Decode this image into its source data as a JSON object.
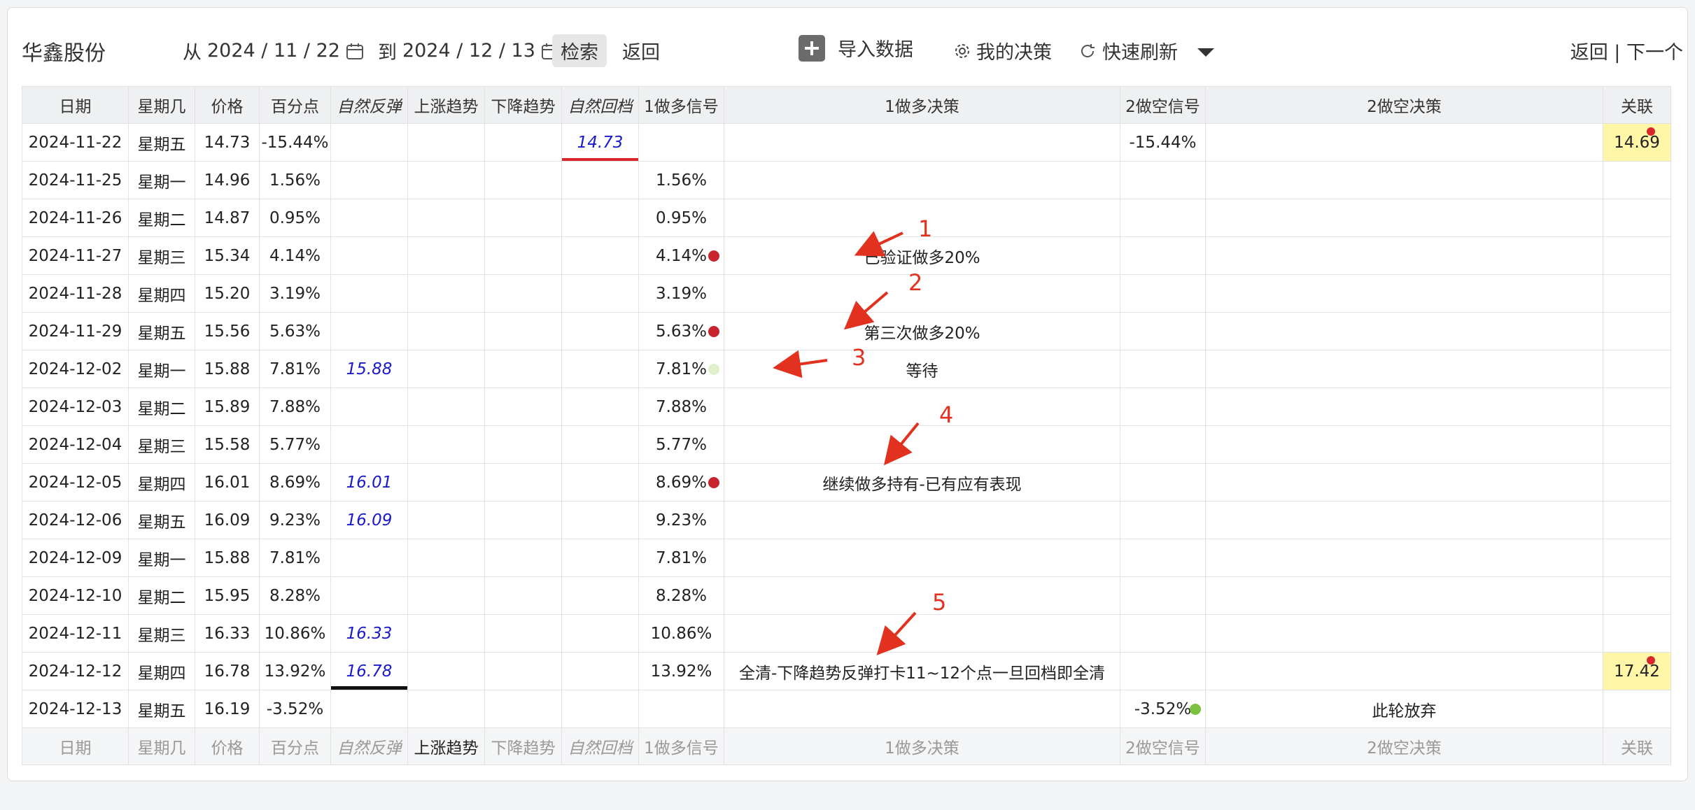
{
  "toolbar": {
    "title": "华鑫股份",
    "date_from_label": "从",
    "date_from": "2024 / 11 / 22",
    "date_to_label": "到",
    "date_to": "2024 / 12 / 13",
    "search_label": "检索",
    "back_label": "返回",
    "import_label": "导入数据",
    "decision_label": "我的决策",
    "refresh_label": "快速刷新",
    "nav_back": "返回",
    "nav_sep": "|",
    "nav_next": "下一个"
  },
  "columns": [
    "日期",
    "星期几",
    "价格",
    "百分点",
    "自然反弹",
    "上涨趋势",
    "下降趋势",
    "自然回档",
    "1做多信号",
    "1做多决策",
    "2做空信号",
    "2做空决策",
    "关联"
  ],
  "rows": [
    {
      "date": "2024-11-22",
      "weekday": "星期五",
      "price": "14.73",
      "pct": "-15.44%",
      "rebound": "",
      "up": "",
      "down": "",
      "pullback": "14.73",
      "sig1": "",
      "dec1": "",
      "sig2": "-15.44%",
      "dec2": "",
      "link": "14.69"
    },
    {
      "date": "2024-11-25",
      "weekday": "星期一",
      "price": "14.96",
      "pct": "1.56%",
      "rebound": "",
      "up": "",
      "down": "",
      "pullback": "",
      "sig1": "1.56%",
      "dec1": "",
      "sig2": "",
      "dec2": "",
      "link": ""
    },
    {
      "date": "2024-11-26",
      "weekday": "星期二",
      "price": "14.87",
      "pct": "0.95%",
      "rebound": "",
      "up": "",
      "down": "",
      "pullback": "",
      "sig1": "0.95%",
      "dec1": "",
      "sig2": "",
      "dec2": "",
      "link": ""
    },
    {
      "date": "2024-11-27",
      "weekday": "星期三",
      "price": "15.34",
      "pct": "4.14%",
      "rebound": "",
      "up": "",
      "down": "",
      "pullback": "",
      "sig1": "4.14%",
      "dec1": "已验证做多20%",
      "sig2": "",
      "dec2": "",
      "link": ""
    },
    {
      "date": "2024-11-28",
      "weekday": "星期四",
      "price": "15.20",
      "pct": "3.19%",
      "rebound": "",
      "up": "",
      "down": "",
      "pullback": "",
      "sig1": "3.19%",
      "dec1": "",
      "sig2": "",
      "dec2": "",
      "link": ""
    },
    {
      "date": "2024-11-29",
      "weekday": "星期五",
      "price": "15.56",
      "pct": "5.63%",
      "rebound": "",
      "up": "",
      "down": "",
      "pullback": "",
      "sig1": "5.63%",
      "dec1": "第三次做多20%",
      "sig2": "",
      "dec2": "",
      "link": ""
    },
    {
      "date": "2024-12-02",
      "weekday": "星期一",
      "price": "15.88",
      "pct": "7.81%",
      "rebound": "15.88",
      "up": "",
      "down": "",
      "pullback": "",
      "sig1": "7.81%",
      "dec1": "等待",
      "sig2": "",
      "dec2": "",
      "link": ""
    },
    {
      "date": "2024-12-03",
      "weekday": "星期二",
      "price": "15.89",
      "pct": "7.88%",
      "rebound": "",
      "up": "",
      "down": "",
      "pullback": "",
      "sig1": "7.88%",
      "dec1": "",
      "sig2": "",
      "dec2": "",
      "link": ""
    },
    {
      "date": "2024-12-04",
      "weekday": "星期三",
      "price": "15.58",
      "pct": "5.77%",
      "rebound": "",
      "up": "",
      "down": "",
      "pullback": "",
      "sig1": "5.77%",
      "dec1": "",
      "sig2": "",
      "dec2": "",
      "link": ""
    },
    {
      "date": "2024-12-05",
      "weekday": "星期四",
      "price": "16.01",
      "pct": "8.69%",
      "rebound": "16.01",
      "up": "",
      "down": "",
      "pullback": "",
      "sig1": "8.69%",
      "dec1": "继续做多持有-已有应有表现",
      "sig2": "",
      "dec2": "",
      "link": ""
    },
    {
      "date": "2024-12-06",
      "weekday": "星期五",
      "price": "16.09",
      "pct": "9.23%",
      "rebound": "16.09",
      "up": "",
      "down": "",
      "pullback": "",
      "sig1": "9.23%",
      "dec1": "",
      "sig2": "",
      "dec2": "",
      "link": ""
    },
    {
      "date": "2024-12-09",
      "weekday": "星期一",
      "price": "15.88",
      "pct": "7.81%",
      "rebound": "",
      "up": "",
      "down": "",
      "pullback": "",
      "sig1": "7.81%",
      "dec1": "",
      "sig2": "",
      "dec2": "",
      "link": ""
    },
    {
      "date": "2024-12-10",
      "weekday": "星期二",
      "price": "15.95",
      "pct": "8.28%",
      "rebound": "",
      "up": "",
      "down": "",
      "pullback": "",
      "sig1": "8.28%",
      "dec1": "",
      "sig2": "",
      "dec2": "",
      "link": ""
    },
    {
      "date": "2024-12-11",
      "weekday": "星期三",
      "price": "16.33",
      "pct": "10.86%",
      "rebound": "16.33",
      "up": "",
      "down": "",
      "pullback": "",
      "sig1": "10.86%",
      "dec1": "",
      "sig2": "",
      "dec2": "",
      "link": ""
    },
    {
      "date": "2024-12-12",
      "weekday": "星期四",
      "price": "16.78",
      "pct": "13.92%",
      "rebound": "16.78",
      "up": "",
      "down": "",
      "pullback": "",
      "sig1": "13.92%",
      "dec1": "全清-下降趋势反弹打卡11~12个点一旦回档即全清",
      "sig2": "",
      "dec2": "",
      "link": "17.42"
    },
    {
      "date": "2024-12-13",
      "weekday": "星期五",
      "price": "16.19",
      "pct": "-3.52%",
      "rebound": "",
      "up": "",
      "down": "",
      "pullback": "",
      "sig1": "",
      "dec1": "",
      "sig2": "-3.52%",
      "dec2": "此轮放弃",
      "link": ""
    }
  ],
  "annotations": [
    "1",
    "2",
    "3",
    "4",
    "5"
  ],
  "colors": {
    "accent_red": "#e3311f",
    "signal_red": "#c9232d",
    "signal_green": "#7cc13d",
    "link_yellow": "#fff6a8",
    "italic_blue": "#1a1acc"
  }
}
